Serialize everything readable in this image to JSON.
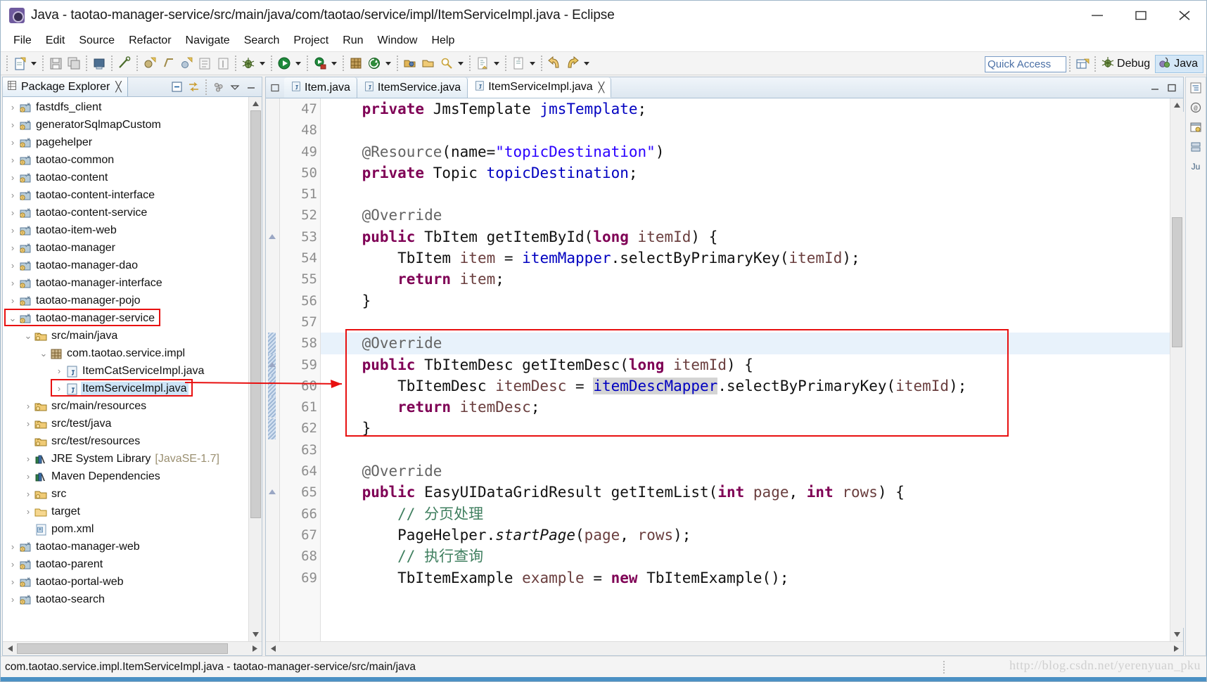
{
  "window": {
    "title": "Java - taotao-manager-service/src/main/java/com/taotao/service/impl/ItemServiceImpl.java - Eclipse",
    "logo_icon": "eclipse-logo-icon",
    "minimize_label": "Minimize",
    "maximize_label": "Maximize",
    "close_label": "Close"
  },
  "menubar": {
    "items": [
      {
        "label": "File"
      },
      {
        "label": "Edit"
      },
      {
        "label": "Source"
      },
      {
        "label": "Refactor"
      },
      {
        "label": "Navigate"
      },
      {
        "label": "Search"
      },
      {
        "label": "Project"
      },
      {
        "label": "Run"
      },
      {
        "label": "Window"
      },
      {
        "label": "Help"
      }
    ]
  },
  "toolbar": {
    "groups": [
      {
        "icons": [
          {
            "name": "new-wizard-icon"
          }
        ],
        "dropdown": true
      },
      {
        "icons": [
          {
            "name": "save-icon"
          },
          {
            "name": "save-all-icon"
          }
        ],
        "dropdown": false
      },
      {
        "icons": [
          {
            "name": "print-icon"
          }
        ],
        "dropdown": false
      },
      {
        "icons": [
          {
            "name": "toggle-mark-occurrences-icon"
          }
        ],
        "dropdown": false
      },
      {
        "icons": [
          {
            "name": "new-java-project-icon"
          },
          {
            "name": "new-package-icon"
          },
          {
            "name": "new-class-icon"
          },
          {
            "name": "new-annotation-icon"
          },
          {
            "name": "new-interface-icon"
          }
        ],
        "dropdown": false
      },
      {
        "icons": [
          {
            "name": "debug-icon"
          }
        ],
        "dropdown": true
      },
      {
        "icons": [
          {
            "name": "run-icon"
          }
        ],
        "dropdown": true
      },
      {
        "icons": [
          {
            "name": "run-external-tools-icon"
          }
        ],
        "dropdown": true
      },
      {
        "icons": [
          {
            "name": "new-maven-project-icon"
          },
          {
            "name": "refresh-maven-icon"
          }
        ],
        "dropdown": true
      },
      {
        "icons": [
          {
            "name": "open-type-icon"
          },
          {
            "name": "open-task-icon"
          },
          {
            "name": "search-icon"
          }
        ],
        "dropdown": true
      },
      {
        "icons": [
          {
            "name": "next-annotation-icon"
          }
        ],
        "dropdown": true
      },
      {
        "icons": [
          {
            "name": "previous-annotation-icon"
          }
        ],
        "dropdown": true
      },
      {
        "icons": [
          {
            "name": "back-history-icon"
          },
          {
            "name": "forward-history-icon"
          }
        ],
        "dropdown": true
      }
    ],
    "quick_access_placeholder": "Quick Access",
    "quick_access_value": "Quick Access",
    "open_perspective_icon": "open-perspective-icon",
    "perspectives": [
      {
        "label": "Debug",
        "icon": "debug-perspective-icon",
        "active": false
      },
      {
        "label": "Java",
        "icon": "java-perspective-icon",
        "active": true
      }
    ]
  },
  "explorer": {
    "tab_label": "Package Explorer",
    "tab_icon": "package-explorer-icon",
    "tab_close": "╳",
    "tools": [
      {
        "name": "collapse-all-icon"
      },
      {
        "name": "link-with-editor-icon"
      },
      {
        "name": "view-menu-focus-icon"
      },
      {
        "name": "view-menu-icon"
      },
      {
        "name": "minimize-view-icon"
      }
    ],
    "tree": [
      {
        "indent": 0,
        "twist": "›",
        "icon": "maven-project-icon",
        "label": "fastdfs_client"
      },
      {
        "indent": 0,
        "twist": "›",
        "icon": "maven-project-icon",
        "label": "generatorSqlmapCustom"
      },
      {
        "indent": 0,
        "twist": "›",
        "icon": "maven-project-icon",
        "label": "pagehelper"
      },
      {
        "indent": 0,
        "twist": "›",
        "icon": "maven-project-icon",
        "label": "taotao-common"
      },
      {
        "indent": 0,
        "twist": "›",
        "icon": "maven-project-icon",
        "label": "taotao-content"
      },
      {
        "indent": 0,
        "twist": "›",
        "icon": "maven-project-icon",
        "label": "taotao-content-interface"
      },
      {
        "indent": 0,
        "twist": "›",
        "icon": "maven-project-icon",
        "label": "taotao-content-service"
      },
      {
        "indent": 0,
        "twist": "›",
        "icon": "maven-project-icon",
        "label": "taotao-item-web"
      },
      {
        "indent": 0,
        "twist": "›",
        "icon": "maven-project-icon",
        "label": "taotao-manager"
      },
      {
        "indent": 0,
        "twist": "›",
        "icon": "maven-project-icon",
        "label": "taotao-manager-dao"
      },
      {
        "indent": 0,
        "twist": "›",
        "icon": "maven-project-icon",
        "label": "taotao-manager-interface"
      },
      {
        "indent": 0,
        "twist": "›",
        "icon": "maven-project-icon",
        "label": "taotao-manager-pojo"
      },
      {
        "indent": 0,
        "twist": "⌄",
        "icon": "maven-project-icon",
        "label": "taotao-manager-service",
        "boxed": true
      },
      {
        "indent": 1,
        "twist": "⌄",
        "icon": "source-folder-icon",
        "label": "src/main/java"
      },
      {
        "indent": 2,
        "twist": "⌄",
        "icon": "package-icon",
        "label": "com.taotao.service.impl"
      },
      {
        "indent": 3,
        "twist": "›",
        "icon": "java-file-icon",
        "label": "ItemCatServiceImpl.java"
      },
      {
        "indent": 3,
        "twist": "›",
        "icon": "java-file-icon",
        "label": "ItemServiceImpl.java",
        "selected": true,
        "boxed": true
      },
      {
        "indent": 1,
        "twist": "›",
        "icon": "source-folder-icon",
        "label": "src/main/resources"
      },
      {
        "indent": 1,
        "twist": "›",
        "icon": "source-folder-icon",
        "label": "src/test/java"
      },
      {
        "indent": 1,
        "twist": "",
        "icon": "source-folder-icon",
        "label": "src/test/resources"
      },
      {
        "indent": 1,
        "twist": "›",
        "icon": "library-icon",
        "label": "JRE System Library",
        "suffix": "[JavaSE-1.7]"
      },
      {
        "indent": 1,
        "twist": "›",
        "icon": "library-icon",
        "label": "Maven Dependencies"
      },
      {
        "indent": 1,
        "twist": "›",
        "icon": "folder-src-icon",
        "label": "src"
      },
      {
        "indent": 1,
        "twist": "›",
        "icon": "folder-icon",
        "label": "target"
      },
      {
        "indent": 1,
        "twist": "",
        "icon": "xml-file-icon",
        "label": "pom.xml"
      },
      {
        "indent": 0,
        "twist": "›",
        "icon": "maven-project-icon",
        "label": "taotao-manager-web"
      },
      {
        "indent": 0,
        "twist": "›",
        "icon": "maven-project-icon",
        "label": "taotao-parent"
      },
      {
        "indent": 0,
        "twist": "›",
        "icon": "maven-project-icon",
        "label": "taotao-portal-web"
      },
      {
        "indent": 0,
        "twist": "›",
        "icon": "maven-project-icon",
        "label": "taotao-search"
      }
    ]
  },
  "editor": {
    "restore_icon": "restore-editor-icon",
    "tabs": [
      {
        "label": "Item.java",
        "icon": "java-file-icon",
        "active": false,
        "closable": false
      },
      {
        "label": "ItemService.java",
        "icon": "java-file-icon",
        "active": false,
        "closable": false
      },
      {
        "label": "ItemServiceImpl.java",
        "icon": "java-file-icon",
        "active": true,
        "closable": true,
        "close": "╳"
      }
    ],
    "tools": [
      {
        "name": "minimize-editor-icon"
      },
      {
        "name": "maximize-editor-icon"
      }
    ],
    "first_line_number": 47,
    "lines": [
      {
        "n": 47,
        "fold": false,
        "tokens": [
          {
            "t": "    ",
            "c": ""
          },
          {
            "t": "private",
            "c": "kw"
          },
          {
            "t": " JmsTemplate ",
            "c": ""
          },
          {
            "t": "jmsTemplate",
            "c": "fld"
          },
          {
            "t": ";",
            "c": ""
          }
        ]
      },
      {
        "n": 48,
        "fold": false,
        "tokens": []
      },
      {
        "n": 49,
        "fold": true,
        "tokens": [
          {
            "t": "    ",
            "c": ""
          },
          {
            "t": "@Resource",
            "c": "ann"
          },
          {
            "t": "(name=",
            "c": ""
          },
          {
            "t": "\"topicDestination\"",
            "c": "str"
          },
          {
            "t": ")",
            "c": ""
          }
        ]
      },
      {
        "n": 50,
        "fold": false,
        "tokens": [
          {
            "t": "    ",
            "c": ""
          },
          {
            "t": "private",
            "c": "kw"
          },
          {
            "t": " Topic ",
            "c": ""
          },
          {
            "t": "topicDestination",
            "c": "fld"
          },
          {
            "t": ";",
            "c": ""
          }
        ]
      },
      {
        "n": 51,
        "fold": false,
        "tokens": []
      },
      {
        "n": 52,
        "fold": true,
        "tokens": [
          {
            "t": "    ",
            "c": ""
          },
          {
            "t": "@Override",
            "c": "ann"
          }
        ]
      },
      {
        "n": 53,
        "fold": false,
        "marker": "tri",
        "tokens": [
          {
            "t": "    ",
            "c": ""
          },
          {
            "t": "public",
            "c": "kw"
          },
          {
            "t": " TbItem getItemById(",
            "c": ""
          },
          {
            "t": "long",
            "c": "kw"
          },
          {
            "t": " ",
            "c": ""
          },
          {
            "t": "itemId",
            "c": "loc"
          },
          {
            "t": ") {",
            "c": ""
          }
        ]
      },
      {
        "n": 54,
        "fold": false,
        "tokens": [
          {
            "t": "        TbItem ",
            "c": ""
          },
          {
            "t": "item",
            "c": "loc"
          },
          {
            "t": " = ",
            "c": ""
          },
          {
            "t": "itemMapper",
            "c": "fld"
          },
          {
            "t": ".selectByPrimaryKey(",
            "c": ""
          },
          {
            "t": "itemId",
            "c": "loc"
          },
          {
            "t": ");",
            "c": ""
          }
        ]
      },
      {
        "n": 55,
        "fold": false,
        "tokens": [
          {
            "t": "        ",
            "c": ""
          },
          {
            "t": "return",
            "c": "kw"
          },
          {
            "t": " ",
            "c": ""
          },
          {
            "t": "item",
            "c": "loc"
          },
          {
            "t": ";",
            "c": ""
          }
        ]
      },
      {
        "n": 56,
        "fold": false,
        "tokens": [
          {
            "t": "    }",
            "c": ""
          }
        ]
      },
      {
        "n": 57,
        "fold": false,
        "tokens": []
      },
      {
        "n": 58,
        "fold": true,
        "current": true,
        "change": "hatch",
        "tokens": [
          {
            "t": "    ",
            "c": ""
          },
          {
            "t": "@Override",
            "c": "ann"
          }
        ]
      },
      {
        "n": 59,
        "fold": false,
        "marker": "tri",
        "change": "hatch",
        "tokens": [
          {
            "t": "    ",
            "c": ""
          },
          {
            "t": "public",
            "c": "kw"
          },
          {
            "t": " TbItemDesc getItemDesc(",
            "c": ""
          },
          {
            "t": "long",
            "c": "kw"
          },
          {
            "t": " ",
            "c": ""
          },
          {
            "t": "itemId",
            "c": "loc"
          },
          {
            "t": ") {",
            "c": ""
          }
        ]
      },
      {
        "n": 60,
        "fold": false,
        "change": "hatch",
        "tokens": [
          {
            "t": "        TbItemDesc ",
            "c": ""
          },
          {
            "t": "itemDesc",
            "c": "loc"
          },
          {
            "t": " = ",
            "c": ""
          },
          {
            "t": "itemDescMapper",
            "c": "fld occ"
          },
          {
            "t": ".selectByPrimaryKey(",
            "c": ""
          },
          {
            "t": "itemId",
            "c": "loc"
          },
          {
            "t": ");",
            "c": ""
          }
        ]
      },
      {
        "n": 61,
        "fold": false,
        "change": "hatch",
        "tokens": [
          {
            "t": "        ",
            "c": ""
          },
          {
            "t": "return",
            "c": "kw"
          },
          {
            "t": " ",
            "c": ""
          },
          {
            "t": "itemDesc",
            "c": "loc"
          },
          {
            "t": ";",
            "c": ""
          }
        ]
      },
      {
        "n": 62,
        "fold": false,
        "change": "hatch",
        "tokens": [
          {
            "t": "    }",
            "c": ""
          }
        ]
      },
      {
        "n": 63,
        "fold": false,
        "tokens": []
      },
      {
        "n": 64,
        "fold": true,
        "tokens": [
          {
            "t": "    ",
            "c": ""
          },
          {
            "t": "@Override",
            "c": "ann"
          }
        ]
      },
      {
        "n": 65,
        "fold": false,
        "marker": "tri",
        "tokens": [
          {
            "t": "    ",
            "c": ""
          },
          {
            "t": "public",
            "c": "kw"
          },
          {
            "t": " EasyUIDataGridResult getItemList(",
            "c": ""
          },
          {
            "t": "int",
            "c": "kw"
          },
          {
            "t": " ",
            "c": ""
          },
          {
            "t": "page",
            "c": "loc"
          },
          {
            "t": ", ",
            "c": ""
          },
          {
            "t": "int",
            "c": "kw"
          },
          {
            "t": " ",
            "c": ""
          },
          {
            "t": "rows",
            "c": "loc"
          },
          {
            "t": ") {",
            "c": ""
          }
        ]
      },
      {
        "n": 66,
        "fold": false,
        "tokens": [
          {
            "t": "        ",
            "c": ""
          },
          {
            "t": "// 分页处理",
            "c": "cmt"
          }
        ]
      },
      {
        "n": 67,
        "fold": false,
        "tokens": [
          {
            "t": "        PageHelper.",
            "c": ""
          },
          {
            "t": "startPage",
            "c": "sta"
          },
          {
            "t": "(",
            "c": ""
          },
          {
            "t": "page",
            "c": "loc"
          },
          {
            "t": ", ",
            "c": ""
          },
          {
            "t": "rows",
            "c": "loc"
          },
          {
            "t": ");",
            "c": ""
          }
        ]
      },
      {
        "n": 68,
        "fold": false,
        "tokens": [
          {
            "t": "        ",
            "c": ""
          },
          {
            "t": "// 执行查询",
            "c": "cmt"
          }
        ]
      },
      {
        "n": 69,
        "fold": false,
        "tokens": [
          {
            "t": "        TbItemExample ",
            "c": ""
          },
          {
            "t": "example",
            "c": "loc"
          },
          {
            "t": " = ",
            "c": ""
          },
          {
            "t": "new",
            "c": "kw"
          },
          {
            "t": " TbItemExample();",
            "c": ""
          }
        ]
      }
    ]
  },
  "right_rail": {
    "icons": [
      {
        "name": "outline-view-icon"
      },
      {
        "name": "task-list-view-icon"
      },
      {
        "name": "properties-view-icon"
      },
      {
        "name": "servers-view-icon"
      },
      {
        "name": "junit-view-icon"
      }
    ],
    "junit_label": "Ju"
  },
  "statusbar": {
    "text": "com.taotao.service.impl.ItemServiceImpl.java - taotao-manager-service/src/main/java",
    "watermark": "http://blog.csdn.net/yerenyuan_pku"
  },
  "annotation": {
    "accent_color": "#e81010",
    "arrow_name": "red-annotation-arrow"
  },
  "colors": {
    "keyword": "#7f0055",
    "string": "#2a00ff",
    "field": "#0000c0",
    "comment": "#3f7f5f",
    "annotation": "#646464",
    "local": "#6a3e3e",
    "selection": "#cce4f7",
    "current_line": "#e8f2fb",
    "occurrence": "#d4d4d4"
  }
}
